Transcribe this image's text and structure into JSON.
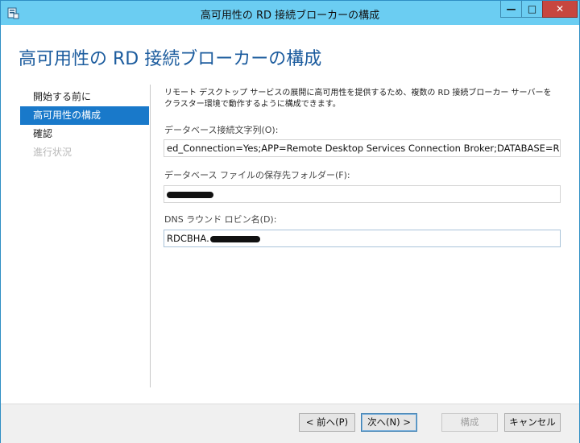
{
  "window": {
    "title": "高可用性の RD 接続ブローカーの構成",
    "controls": {
      "minimize": "—",
      "maximize": "□",
      "close": "✕"
    }
  },
  "heading": "高可用性の RD 接続ブローカーの構成",
  "nav": {
    "items": [
      {
        "label": "開始する前に",
        "state": "normal"
      },
      {
        "label": "高可用性の構成",
        "state": "active"
      },
      {
        "label": "確認",
        "state": "normal"
      },
      {
        "label": "進行状況",
        "state": "disabled"
      }
    ]
  },
  "description": "リモート デスクトップ サービスの展開に高可用性を提供するため、複数の RD 接続ブローカー サーバーをクラスター環境で動作するように構成できます。",
  "fields": {
    "db_connection": {
      "label": "データベース接続文字列(O):",
      "value": "ed_Connection=Yes;APP=Remote Desktop Services Connection Broker;DATABASE=RDCB"
    },
    "db_folder": {
      "label": "データベース ファイルの保存先フォルダー(F):",
      "value": ""
    },
    "dns_name": {
      "label": "DNS ラウンド ロビン名(D):",
      "value": "RDCBHA."
    }
  },
  "buttons": {
    "back": "< 前へ(P)",
    "next": "次へ(N) >",
    "configure": "構成",
    "cancel": "キャンセル"
  },
  "colors": {
    "titlebar": "#6bcdf2",
    "heading": "#1c5c9e",
    "nav_active": "#1979ca",
    "close_button": "#c7463f"
  }
}
